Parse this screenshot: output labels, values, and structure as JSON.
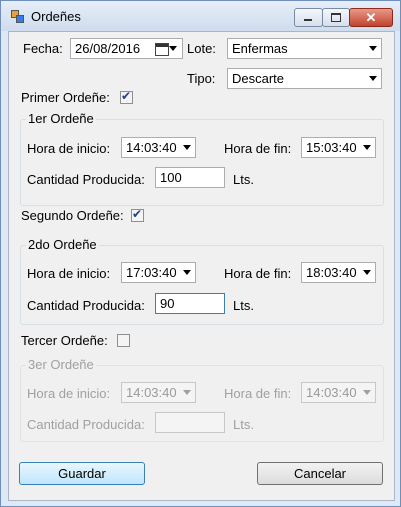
{
  "window": {
    "title": "Ordeñes"
  },
  "header": {
    "fecha_label": "Fecha:",
    "fecha_value": "26/08/2016",
    "lote_label": "Lote:",
    "lote_value": "Enfermas",
    "tipo_label": "Tipo:",
    "tipo_value": "Descarte"
  },
  "milkings": [
    {
      "check_label": "Primer Ordeñe:",
      "checked": true,
      "group_title": "1er Ordeñe",
      "start_label": "Hora de inicio:",
      "start_value": "14:03:40",
      "end_label": "Hora de fin:",
      "end_value": "15:03:40",
      "qty_label": "Cantidad Producida:",
      "qty_value": "100",
      "unit": "Lts.",
      "enabled": true
    },
    {
      "check_label": "Segundo Ordeñe:",
      "checked": true,
      "group_title": "2do Ordeñe",
      "start_label": "Hora de inicio:",
      "start_value": "17:03:40",
      "end_label": "Hora de fin:",
      "end_value": "18:03:40",
      "qty_label": "Cantidad Producida:",
      "qty_value": "90",
      "unit": "Lts.",
      "enabled": true
    },
    {
      "check_label": "Tercer Ordeñe:",
      "checked": false,
      "group_title": "3er Ordeñe",
      "start_label": "Hora de inicio:",
      "start_value": "14:03:40",
      "end_label": "Hora de fin:",
      "end_value": "14:03:40",
      "qty_label": "Cantidad Producida:",
      "qty_value": "",
      "unit": "Lts.",
      "enabled": false
    }
  ],
  "buttons": {
    "save": "Guardar",
    "cancel": "Cancelar"
  },
  "icons": {
    "app": "app-icon",
    "calendar": "calendar-icon",
    "minimize": "minimize-icon",
    "maximize": "maximize-icon",
    "close": "close-icon"
  }
}
